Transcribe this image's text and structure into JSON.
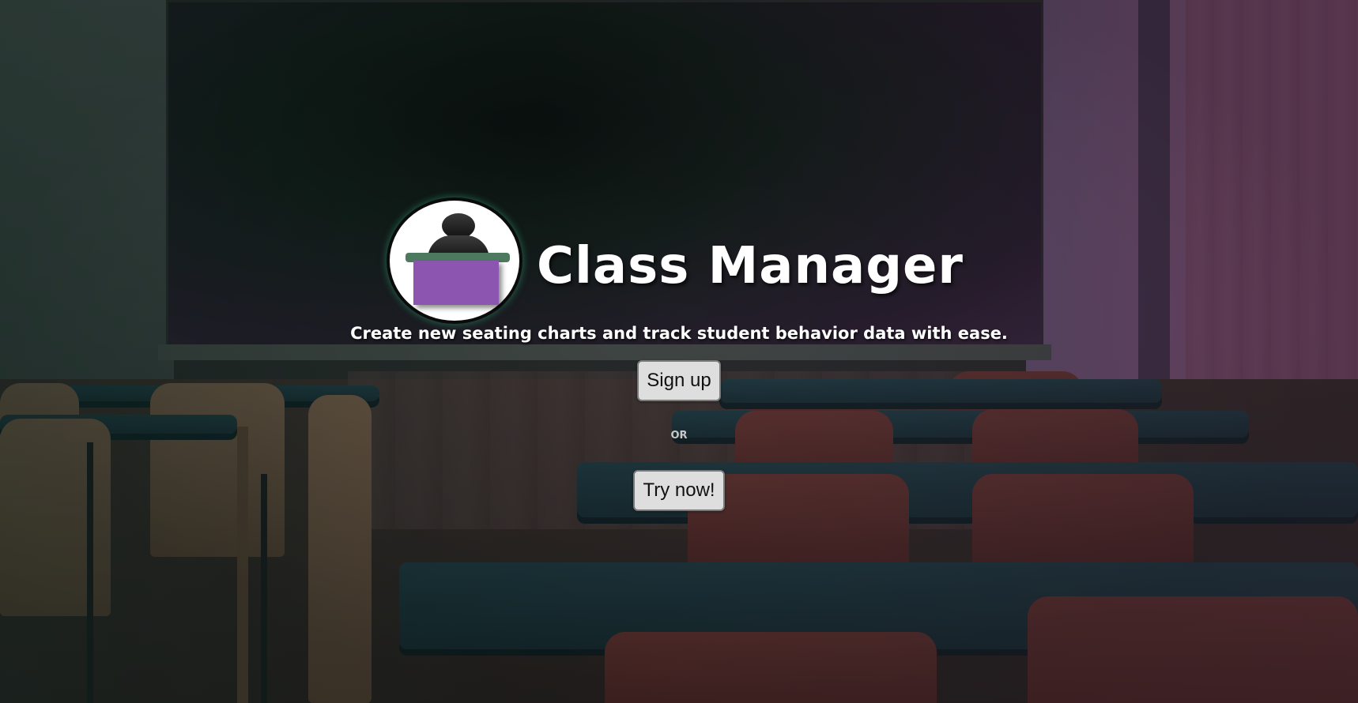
{
  "brand": {
    "app_name": "Class Manager",
    "logo_icon": "teacher-at-desk-icon",
    "colors": {
      "desk_front": "#8c55b0",
      "desk_top": "#4d7a5f"
    }
  },
  "hero": {
    "tagline": "Create new seating charts and track student behavior data with ease.",
    "signup_label": "Sign up",
    "or_label": "OR",
    "try_label": "Try now!"
  }
}
